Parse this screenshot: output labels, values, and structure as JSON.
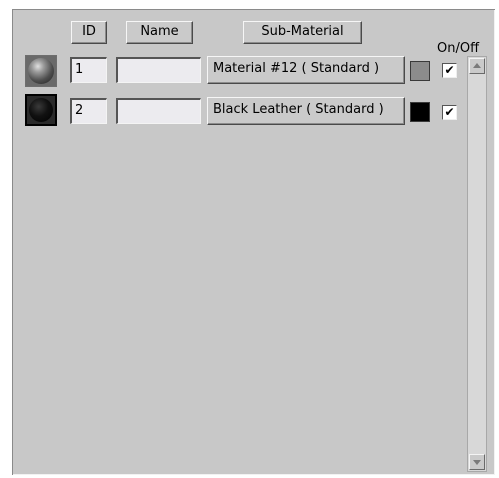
{
  "header": {
    "id_label": "ID",
    "name_label": "Name",
    "submaterial_label": "Sub-Material",
    "onoff_label": "On/Off"
  },
  "rows": [
    {
      "id": "1",
      "name": "",
      "material": "Material #12  ( Standard )",
      "swatch_color": "#8c8c8c",
      "enabled": true,
      "check_glyph": "✔",
      "preview_icon": "gray-sphere-icon",
      "selected": false
    },
    {
      "id": "2",
      "name": "",
      "material": "Black Leather  ( Standard )",
      "swatch_color": "#000000",
      "enabled": true,
      "check_glyph": "✔",
      "preview_icon": "black-sphere-icon",
      "selected": true
    }
  ],
  "scrollbar": {
    "up_icon": "scroll-up-icon",
    "down_icon": "scroll-down-icon"
  }
}
